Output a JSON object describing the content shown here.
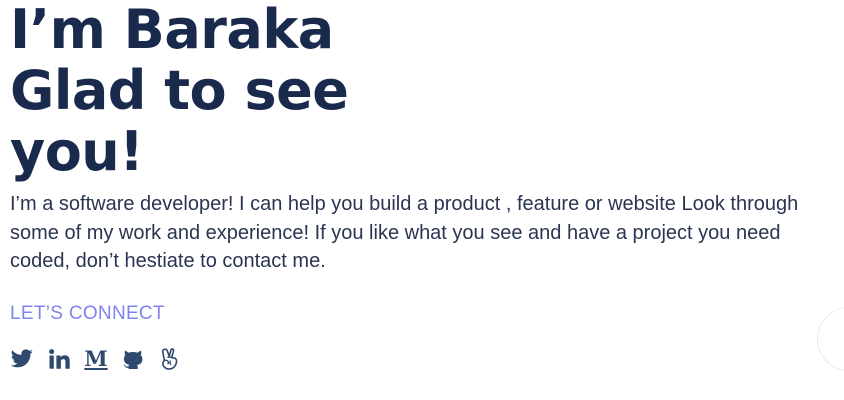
{
  "hero": {
    "headline_line1": "I’m Baraka",
    "headline_line2": "Glad to see",
    "headline_line3": "you!",
    "intro": "I’m a software developer! I can help you build a product , feature or website Look through some of my work and experience! If you like what you see and have a project you need coded, don’t hestiate to contact me.",
    "connect_label": "LET’S CONNECT"
  },
  "socials": [
    {
      "icon": "twitter-icon"
    },
    {
      "icon": "linkedin-icon"
    },
    {
      "icon": "medium-icon",
      "glyph": "M"
    },
    {
      "icon": "github-icon"
    },
    {
      "icon": "angellist-icon"
    }
  ],
  "colors": {
    "headline": "#192a4d",
    "body_text": "#2b3552",
    "accent": "#7d86f0",
    "icons": "#2f4a6e",
    "background": "#ffffff"
  }
}
